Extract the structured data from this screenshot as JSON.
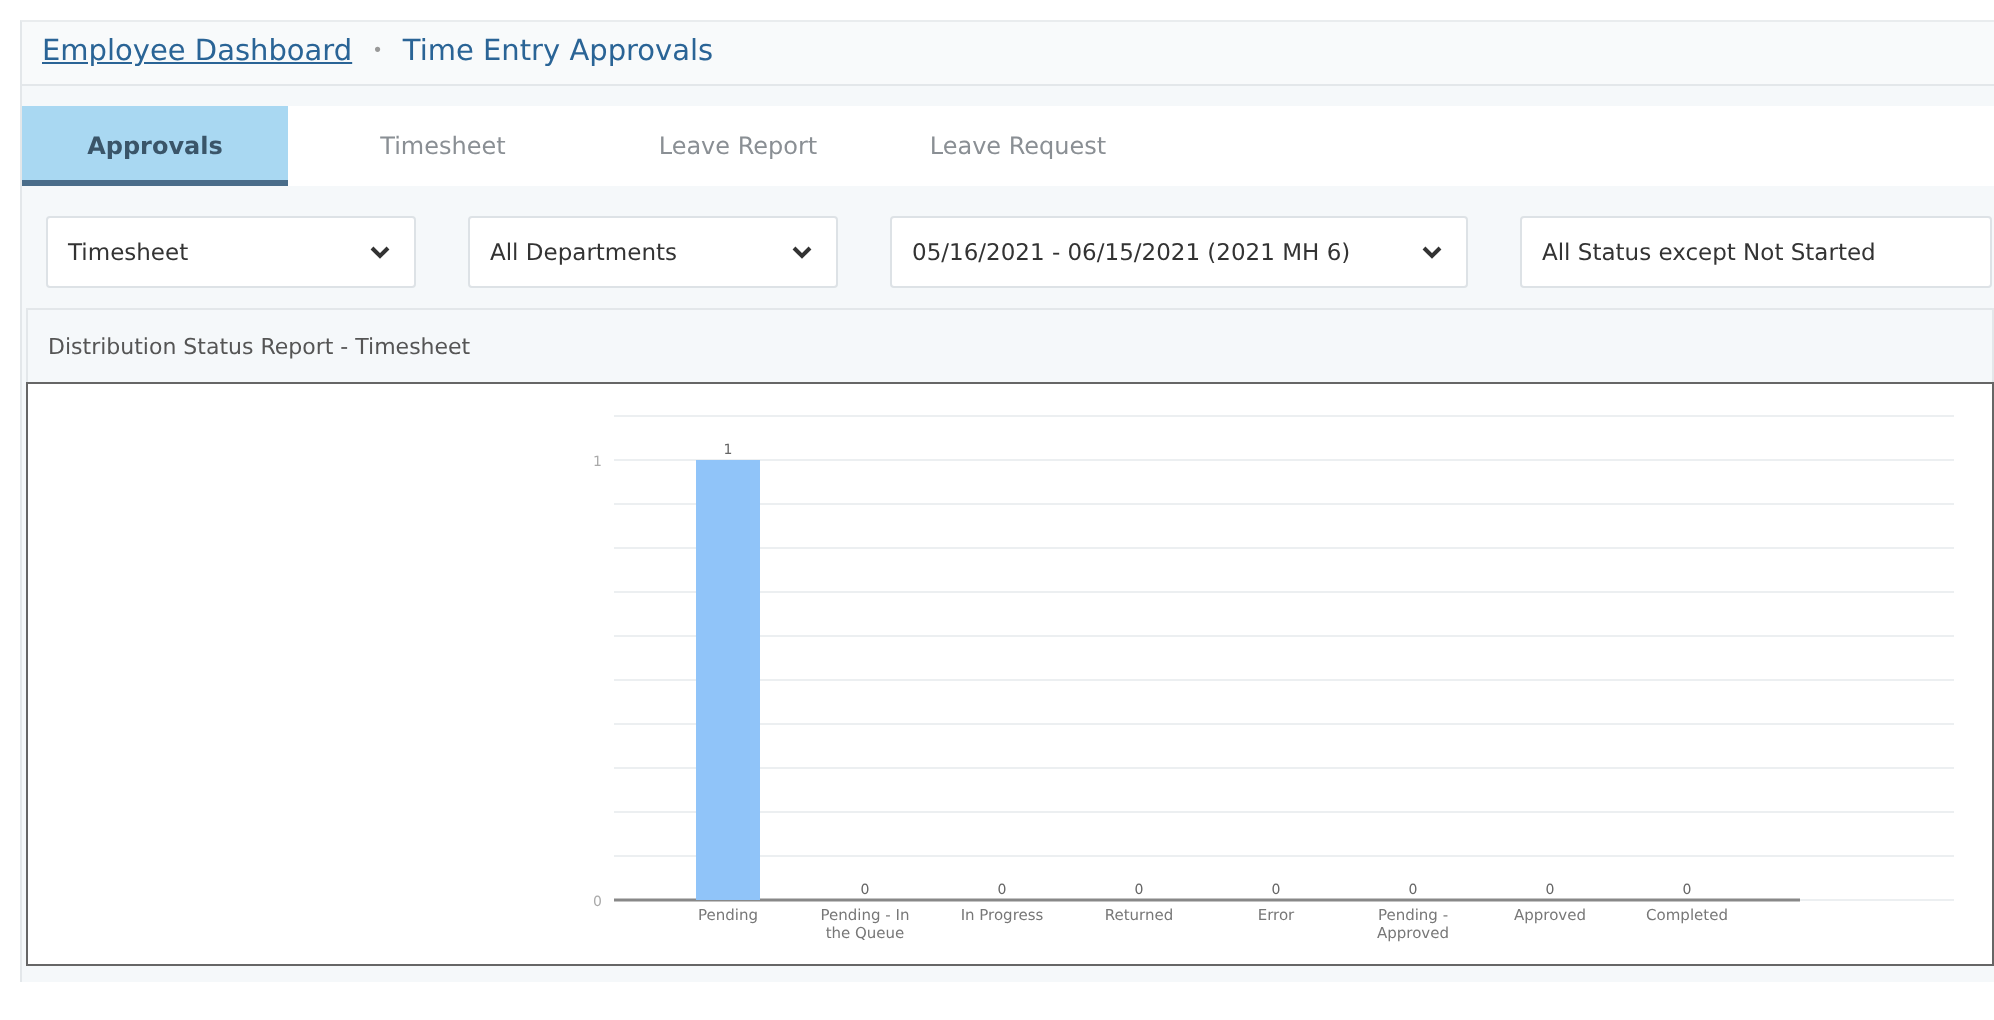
{
  "breadcrumb": {
    "link": "Employee Dashboard",
    "separator": "•",
    "current": "Time Entry Approvals"
  },
  "tabs": [
    {
      "label": "Approvals",
      "selected": true
    },
    {
      "label": "Timesheet",
      "selected": false
    },
    {
      "label": "Leave Report",
      "selected": false
    },
    {
      "label": "Leave Request",
      "selected": false
    }
  ],
  "filters": [
    {
      "value": "Timesheet",
      "has_chevron": true
    },
    {
      "value": "All Departments",
      "has_chevron": true
    },
    {
      "value": "05/16/2021 - 06/15/2021 (2021 MH 6)",
      "has_chevron": true
    },
    {
      "value": "All Status except Not Started",
      "has_chevron": false
    }
  ],
  "report": {
    "title": "Distribution Status Report - Timesheet",
    "chart_data": {
      "type": "bar",
      "categories": [
        "Pending",
        "Pending - In the Queue",
        "In Progress",
        "Returned",
        "Error",
        "Pending - Approved",
        "Approved",
        "Completed"
      ],
      "series": [
        {
          "color": "#90c4f9",
          "values": [
            1,
            0,
            0,
            0,
            0,
            0,
            0,
            0
          ]
        }
      ],
      "ylim": [
        0,
        1
      ],
      "yticks": [
        0,
        1
      ],
      "data_labels": true
    }
  }
}
